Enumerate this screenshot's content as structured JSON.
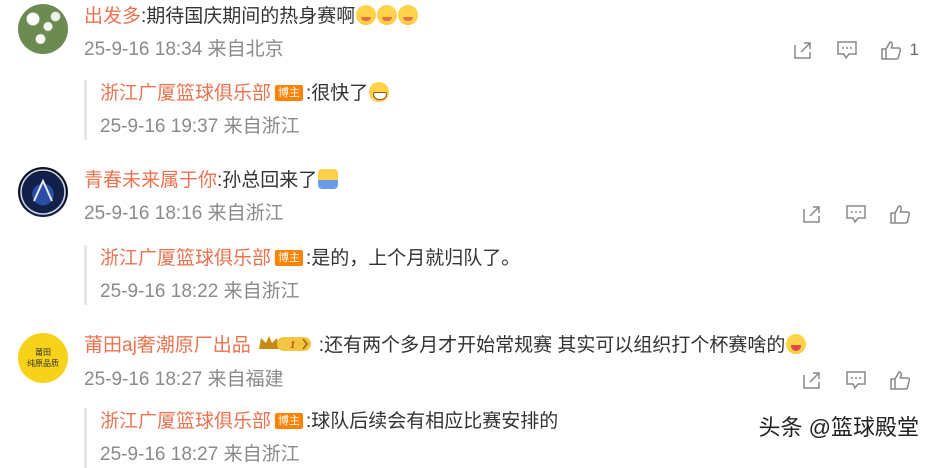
{
  "comments": [
    {
      "username": "出发多",
      "text": ":期待国庆期间的热身赛啊",
      "emojis": [
        "shy",
        "shy",
        "shy"
      ],
      "time": "25-9-16 18:34",
      "location": "来自北京",
      "likes": "1",
      "avatar": "flower-avatar",
      "reply": {
        "username": "浙江广厦篮球俱乐部",
        "badge": "博主",
        "text": ":很快了",
        "emoji": "grin",
        "time": "25-9-16 19:37",
        "location": "来自浙江"
      }
    },
    {
      "username": "青春未来属于你",
      "text": ":孙总回来了",
      "emojis": [
        "hug"
      ],
      "time": "25-9-16 18:16",
      "location": "来自浙江",
      "likes": "",
      "avatar": "inter-avatar",
      "reply": {
        "username": "浙江广厦篮球俱乐部",
        "badge": "博主",
        "text": ":是的，上个月就归队了。",
        "time": "25-9-16 18:22",
        "location": "来自浙江"
      }
    },
    {
      "username": "莆田aj奢潮原厂出品",
      "vip_level": "1",
      "text": ":还有两个多月才开始常规赛   其实可以组织打个杯赛啥的",
      "emojis": [
        "tongue"
      ],
      "time": "25-9-16 18:27",
      "location": "来自福建",
      "likes": "",
      "avatar_text": [
        "莆田",
        "纯原品质"
      ],
      "reply": {
        "username": "浙江广厦篮球俱乐部",
        "badge": "博主",
        "text": ":球队后续会有相应比赛安排的",
        "time": "25-9-16 18:27",
        "location": "来自浙江"
      }
    }
  ],
  "watermark": "头条 @篮球殿堂",
  "icons": [
    "share-icon",
    "comment-icon",
    "like-icon"
  ],
  "colors": {
    "username": "#eb7350",
    "meta": "#8a8a8a",
    "badge": "#ff8200",
    "text": "#333333"
  }
}
